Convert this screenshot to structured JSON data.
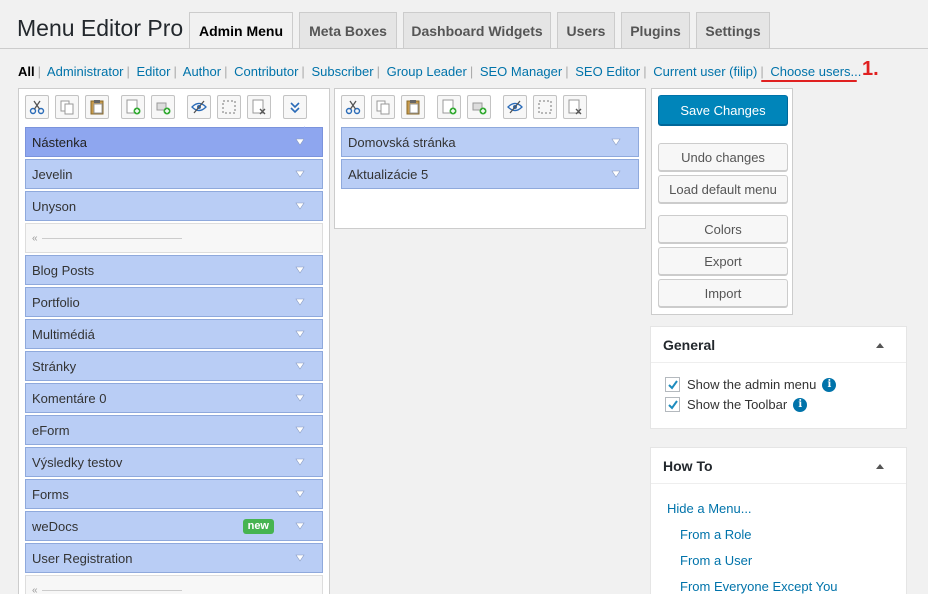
{
  "page_title": "Menu Editor Pro",
  "tabs": [
    {
      "label": "Admin Menu",
      "active": true
    },
    {
      "label": "Meta Boxes"
    },
    {
      "label": "Dashboard Widgets"
    },
    {
      "label": "Users"
    },
    {
      "label": "Plugins"
    },
    {
      "label": "Settings"
    }
  ],
  "roles": {
    "all": "All",
    "items": [
      "Administrator",
      "Editor",
      "Author",
      "Contributor",
      "Subscriber",
      "Group Leader",
      "SEO Manager",
      "SEO Editor",
      "Current user (filip)",
      "Choose users..."
    ]
  },
  "annotation": {
    "number": "1.",
    "color": "#e02020"
  },
  "column1": {
    "items": [
      "Nástenka",
      "Jevelin",
      "Unyson",
      "Blog Posts",
      "Portfolio",
      "Multimédiá",
      "Stránky",
      "Komentáre 0",
      "eForm",
      "Výsledky testov",
      "Forms",
      "weDocs",
      "User Registration"
    ],
    "badge": "new"
  },
  "column2": {
    "items": [
      "Domovská stránka",
      "Aktualizácie 5"
    ]
  },
  "actions": {
    "save": "Save Changes",
    "undo": "Undo changes",
    "load_default": "Load default menu",
    "colors": "Colors",
    "export": "Export",
    "import": "Import"
  },
  "general_box": {
    "title": "General",
    "show_admin_menu": "Show the admin menu",
    "show_toolbar": "Show the Toolbar"
  },
  "howto_box": {
    "title": "How To",
    "links": [
      "Hide a Menu...",
      "From a Role",
      "From a User",
      "From Everyone Except You"
    ]
  },
  "colors": {
    "accent": "#0085ba",
    "item_bg": "#b9cdf5",
    "item_selected": "#8ea6ef",
    "badge": "#46b450",
    "link": "#0073aa"
  }
}
